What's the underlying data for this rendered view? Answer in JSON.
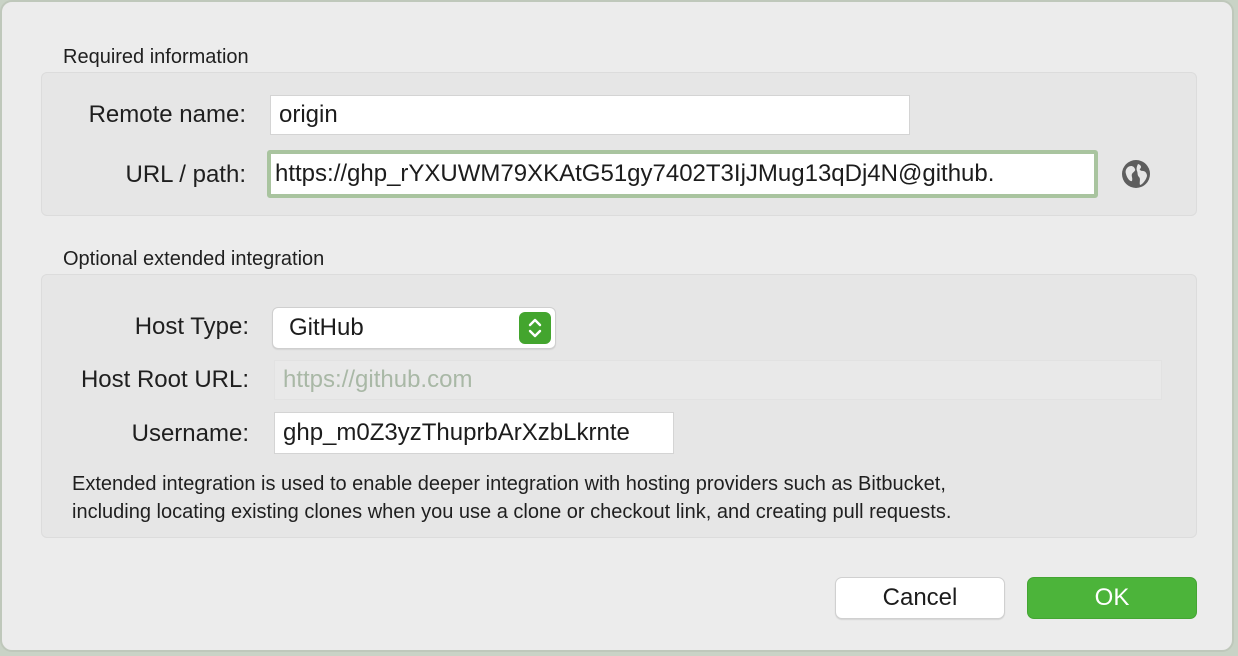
{
  "required": {
    "title": "Required information",
    "remote_name_label": "Remote name:",
    "remote_name_value": "origin",
    "url_label": "URL / path:",
    "url_value": "https://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@github.",
    "globe_icon": "globe-icon"
  },
  "optional": {
    "title": "Optional extended integration",
    "host_type_label": "Host Type:",
    "host_type_value": "GitHub",
    "host_root_label": "Host Root URL:",
    "host_root_placeholder": "https://github.com",
    "username_label": "Username:",
    "username_value": "ghp_m0Z3yzThuprbArXzbLkrnte",
    "note_line1": "Extended integration is used to enable deeper integration with hosting providers such as Bitbucket,",
    "note_line2": "including locating existing clones when you use a clone or checkout link, and creating pull requests."
  },
  "buttons": {
    "cancel": "Cancel",
    "ok": "OK"
  },
  "colors": {
    "accent": "#4cb43a",
    "focus_ring": "#a9c49f"
  }
}
